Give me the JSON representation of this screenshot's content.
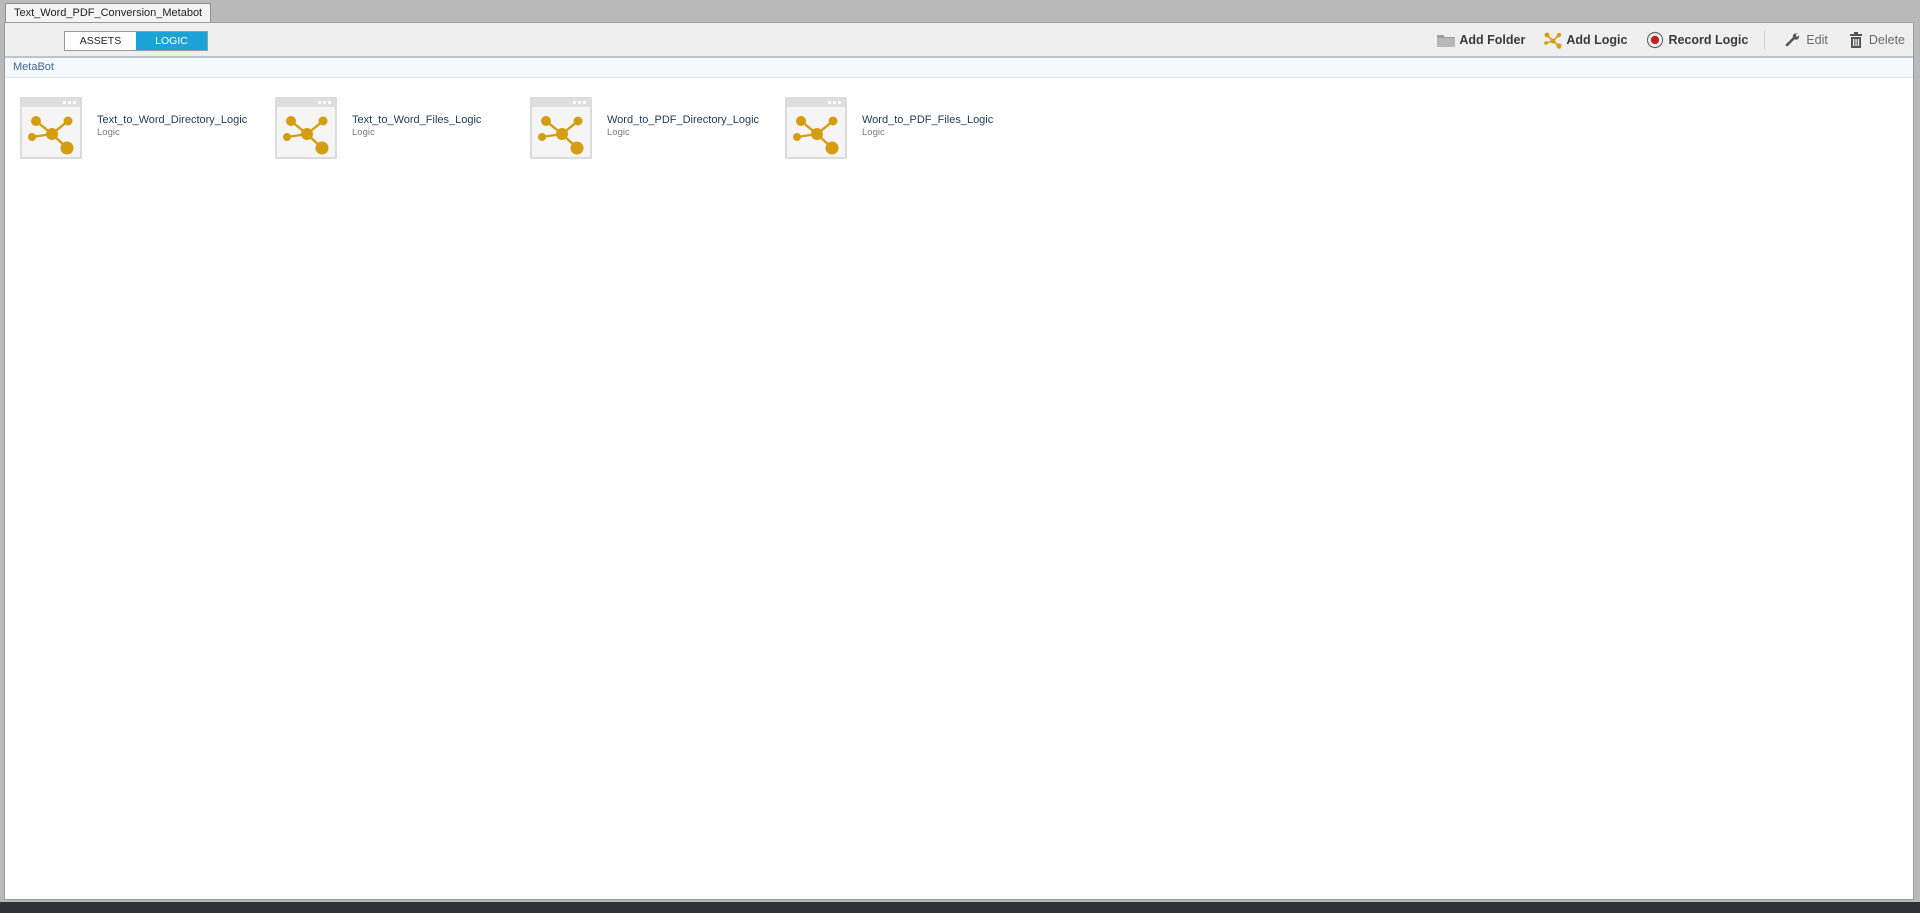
{
  "window": {
    "tab_title": "Text_Word_PDF_Conversion_Metabot"
  },
  "toggle": {
    "assets_label": "ASSETS",
    "logic_label": "LOGIC",
    "active": "LOGIC"
  },
  "toolbar": {
    "add_folder_label": "Add Folder",
    "add_logic_label": "Add Logic",
    "record_logic_label": "Record Logic",
    "edit_label": "Edit",
    "delete_label": "Delete",
    "icons": [
      "folder-icon",
      "logic-icon",
      "record-icon",
      "wrench-icon",
      "trash-icon"
    ]
  },
  "breadcrumb": {
    "label": "MetaBot"
  },
  "items": [
    {
      "name": "Text_to_Word_Directory_Logic",
      "type": "Logic",
      "icon": "logic-thumbnail-icon"
    },
    {
      "name": "Text_to_Word_Files_Logic",
      "type": "Logic",
      "icon": "logic-thumbnail-icon"
    },
    {
      "name": "Word_to_PDF_Directory_Logic",
      "type": "Logic",
      "icon": "logic-thumbnail-icon"
    },
    {
      "name": "Word_to_PDF_Files_Logic",
      "type": "Logic",
      "icon": "logic-thumbnail-icon"
    }
  ],
  "colors": {
    "accent": "#1ba3d8",
    "logic_icon": "#d49d12",
    "record": "#c81e1e"
  }
}
